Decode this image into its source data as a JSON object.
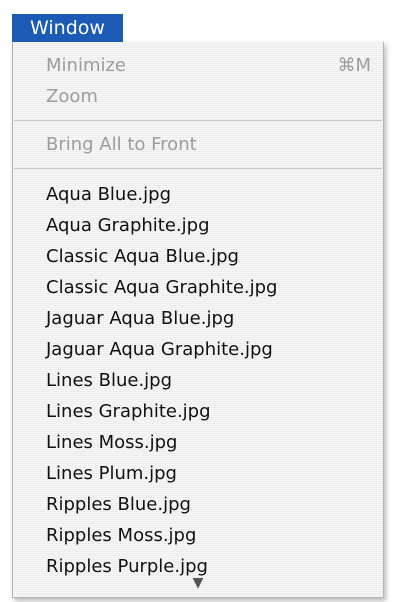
{
  "menu": {
    "title": "Window",
    "minimize_label": "Minimize",
    "minimize_shortcut": "⌘M",
    "zoom_label": "Zoom",
    "bring_all_label": "Bring All to Front",
    "files": [
      "Aqua Blue.jpg",
      "Aqua Graphite.jpg",
      "Classic Aqua Blue.jpg",
      "Classic Aqua Graphite.jpg",
      "Jaguar Aqua Blue.jpg",
      "Jaguar Aqua Graphite.jpg",
      "Lines Blue.jpg",
      "Lines Graphite.jpg",
      "Lines Moss.jpg",
      "Lines Plum.jpg",
      "Ripples Blue.jpg",
      "Ripples Moss.jpg",
      "Ripples Purple.jpg"
    ],
    "scroll_icon": "chevron-down-icon",
    "scroll_glyph": "▼"
  },
  "colors": {
    "menu_title_bg": "#1c5bb5",
    "disabled_text": "#9c9c9c",
    "enabled_text": "#111111"
  }
}
